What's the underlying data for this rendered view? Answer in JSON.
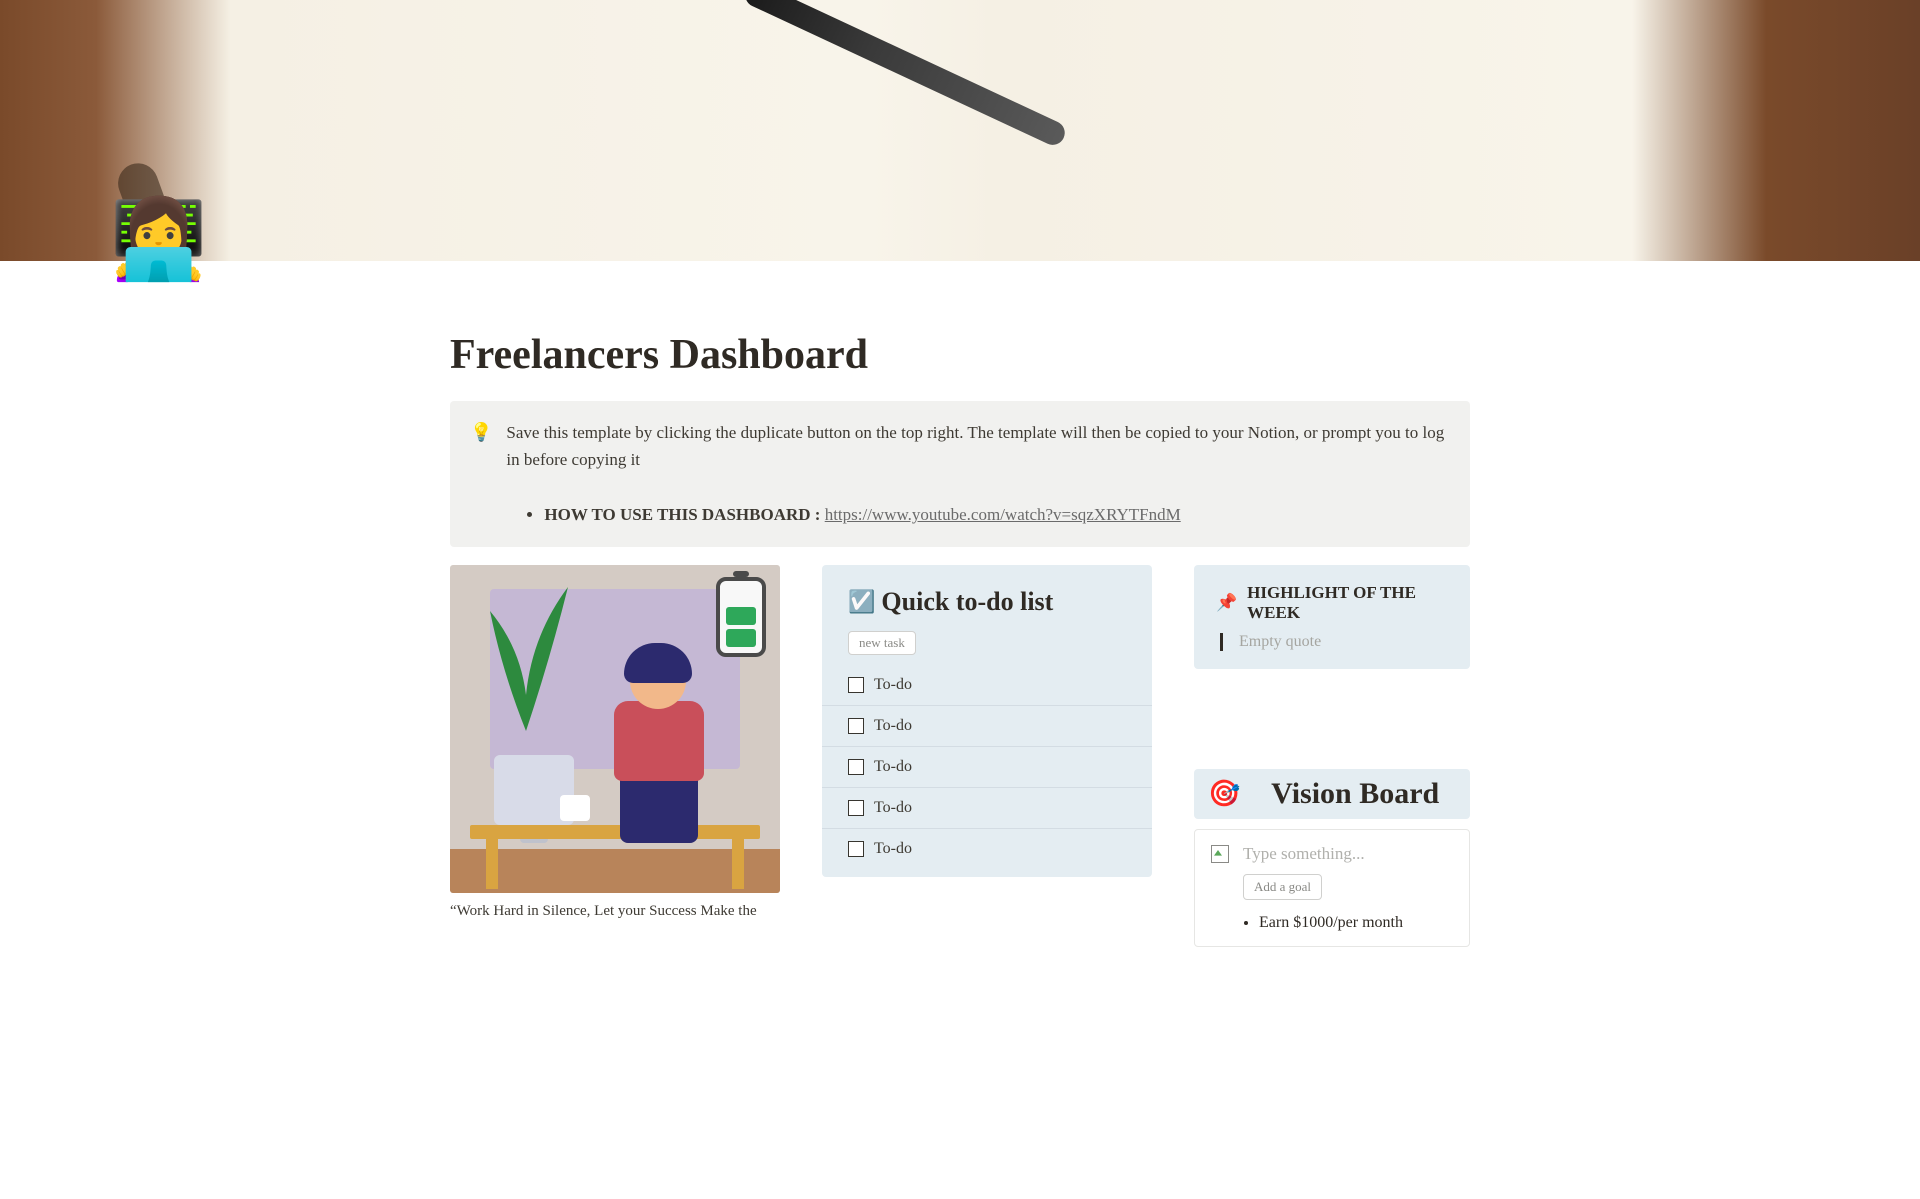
{
  "page": {
    "title": "Freelancers Dashboard",
    "icon": "👩‍💻"
  },
  "callout": {
    "icon": "💡",
    "text": "Save this template by clicking the duplicate button on the top right. The template will then be copied to your Notion, or prompt you to log in before copying it",
    "howto_label": "HOW TO USE THIS DASHBOARD :",
    "howto_url": "https://www.youtube.com/watch?v=sqzXRYTFndM"
  },
  "illustration": {
    "caption": "“Work Hard in Silence, Let your Success Make the"
  },
  "todo": {
    "heading": "Quick to-do list",
    "icon": "☑️",
    "new_task_label": "new task",
    "items": [
      "To-do",
      "To-do",
      "To-do",
      "To-do",
      "To-do"
    ]
  },
  "highlight": {
    "icon": "📌",
    "label": "HIGHLIGHT OF THE WEEK",
    "quote_placeholder": "Empty quote"
  },
  "vision": {
    "icon": "🎯",
    "title": "Vision Board",
    "type_placeholder": "Type something...",
    "add_goal_label": "Add a goal",
    "goals": [
      "Earn $1000/per month"
    ]
  }
}
